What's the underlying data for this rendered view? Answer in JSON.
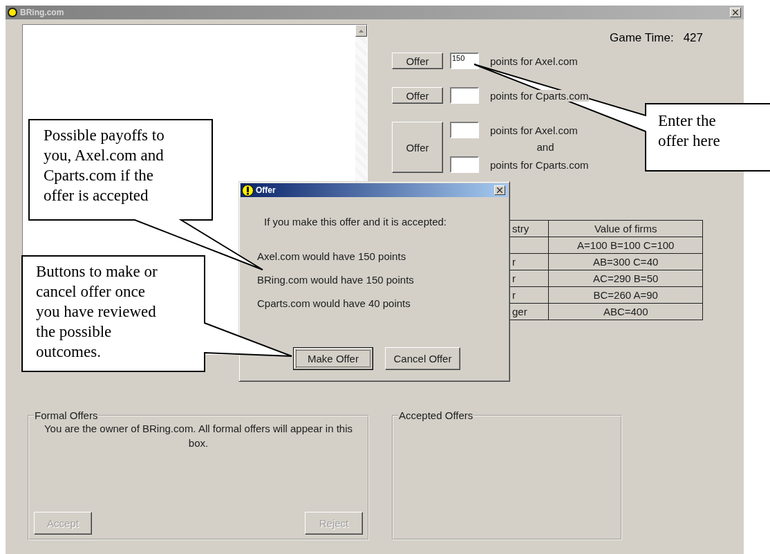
{
  "window": {
    "title": "BRing.com"
  },
  "game_time": {
    "label": "Game Time:",
    "value": "427"
  },
  "offers": [
    {
      "kind": "single",
      "button": "Offer",
      "fields": [
        {
          "value": "150",
          "label": "points for Axel.com"
        }
      ]
    },
    {
      "kind": "single",
      "button": "Offer",
      "fields": [
        {
          "label": "points for Cparts.com"
        }
      ]
    },
    {
      "kind": "joint",
      "button": "Offer",
      "joiner": "and",
      "fields": [
        {
          "label": "points for Axel.com"
        },
        {
          "label": "points for Cparts.com"
        }
      ]
    }
  ],
  "firms_table": {
    "columns": [
      "stry",
      "Value of firms"
    ],
    "rows": [
      {
        "value": "A=100  B=100  C=100"
      },
      {
        "column_1": "r",
        "value": "AB=300  C=40"
      },
      {
        "column_1": "r",
        "value": "AC=290  B=50"
      },
      {
        "column_1": "r",
        "value": "BC=260  A=90"
      },
      {
        "column_1": "ger",
        "value": "ABC=400"
      }
    ]
  },
  "formal_offers": {
    "title": "Formal Offers",
    "message": "You are the owner of BRing.com. All formal offers will appear in this box.",
    "buttons": [
      {
        "label": "Accept",
        "disabled": true
      },
      {
        "label": "Reject",
        "disabled": true
      }
    ]
  },
  "accepted_offers": {
    "title": "Accepted Offers"
  },
  "dialog": {
    "title": "Offer",
    "heading": "If you make this offer and it is accepted:",
    "outcomes": [
      "Axel.com would have 150 points",
      "BRing.com would have 150 points",
      "Cparts.com would have 40 points"
    ],
    "buttons": [
      {
        "label": "Make Offer",
        "focused": true
      },
      {
        "label": "Cancel Offer",
        "focused": false
      }
    ]
  },
  "callouts": [
    {
      "text": "Possible payoffs to\nyou, Axel.com and\nCparts.com if the\noffer is accepted"
    },
    {
      "text": "Buttons to make or\ncancel offer once\nyou have reviewed\nthe possible\noutcomes."
    },
    {
      "text": "Enter the\noffer here"
    }
  ]
}
